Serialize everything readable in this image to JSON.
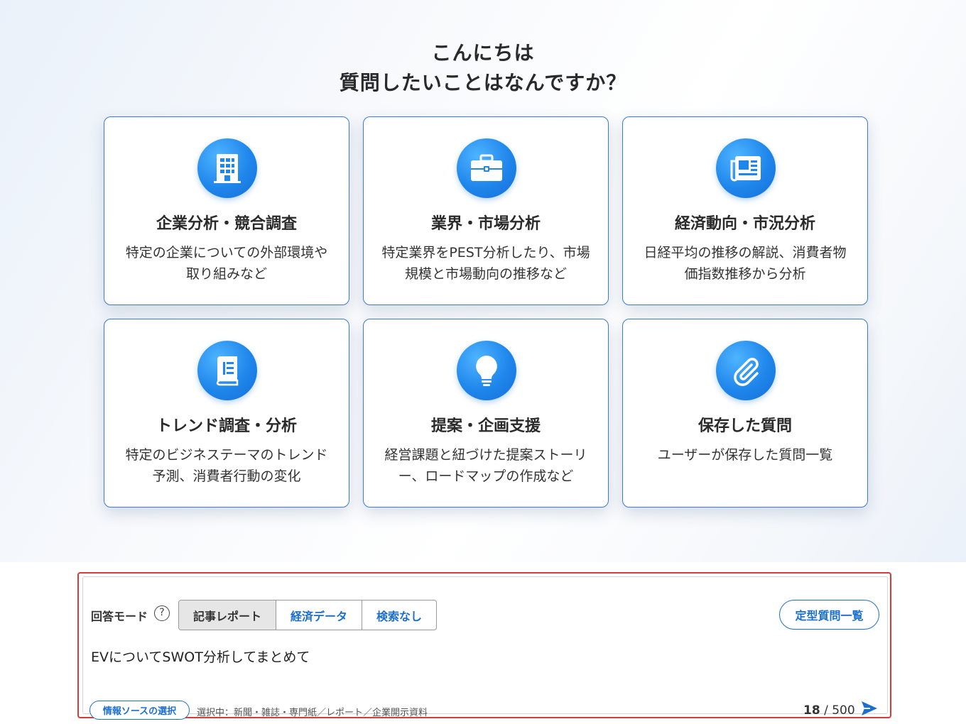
{
  "greeting": {
    "line1": "こんにちは",
    "line2": "質問したいことはなんですか？"
  },
  "cards": [
    {
      "title": "企業分析・競合調査",
      "desc": "特定の企業についての外部環境や取り組みなど",
      "icon": "building-icon"
    },
    {
      "title": "業界・市場分析",
      "desc": "特定業界をPEST分析したり、市場規模と市場動向の推移など",
      "icon": "briefcase-icon"
    },
    {
      "title": "経済動向・市況分析",
      "desc": "日経平均の推移の解説、消費者物価指数推移から分析",
      "icon": "newspaper-icon"
    },
    {
      "title": "トレンド調査・分析",
      "desc": "特定のビジネステーマのトレンド予測、消費者行動の変化",
      "icon": "book-icon"
    },
    {
      "title": "提案・企画支援",
      "desc": "経営課題と紐づけた提案ストーリー、ロードマップの作成など",
      "icon": "lightbulb-icon"
    },
    {
      "title": "保存した質問",
      "desc": "ユーザーが保存した質問一覧",
      "icon": "paperclip-icon"
    }
  ],
  "input_panel": {
    "mode_label": "回答モード",
    "help": "?",
    "modes": [
      "記事レポート",
      "経済データ",
      "検索なし"
    ],
    "selected_mode": "記事レポート",
    "preset_button": "定型質問一覧",
    "query_value": "EVについてSWOT分析してまとめて",
    "source_button": "情報ソースの選択",
    "source_info": "選択中：新聞・雑誌・専門紙／レポート／企業開示資料",
    "char_count": "18",
    "char_max": "/ 500"
  },
  "colors": {
    "accent": "#1c6fcf",
    "card_border": "#3a7bd5",
    "highlight": "#d93a3a"
  }
}
